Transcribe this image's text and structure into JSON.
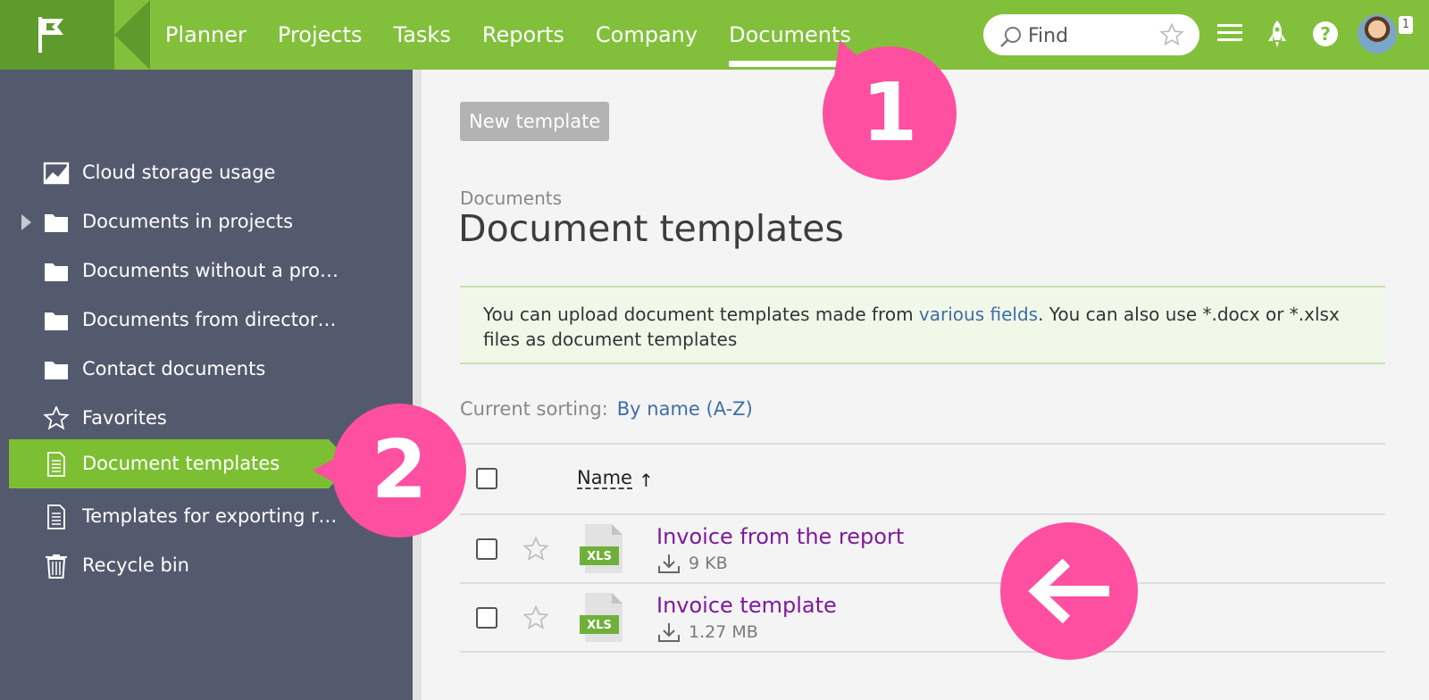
{
  "colors": {
    "topbar": "#82c03c",
    "sidebar": "#545a6e",
    "active": "#7dbf33",
    "callout": "#ff4fa0",
    "link": "#3e6ea8",
    "file_link": "#7d1a9c"
  },
  "nav": {
    "items": [
      {
        "label": "Planner"
      },
      {
        "label": "Projects"
      },
      {
        "label": "Tasks"
      },
      {
        "label": "Reports"
      },
      {
        "label": "Company"
      },
      {
        "label": "Documents",
        "active": true
      }
    ]
  },
  "search": {
    "placeholder": "Find"
  },
  "header_icons": [
    "menu-icon",
    "rocket-icon",
    "help-icon"
  ],
  "user": {
    "notification_count": "1"
  },
  "sidebar": {
    "items": [
      {
        "label": "Cloud storage usage",
        "icon": "chart-icon"
      },
      {
        "label": "Documents in projects",
        "icon": "folder-icon",
        "expandable": true
      },
      {
        "label": "Documents without a proj…",
        "icon": "folder-icon"
      },
      {
        "label": "Documents from directories",
        "icon": "folder-icon"
      },
      {
        "label": "Contact documents",
        "icon": "folder-icon"
      },
      {
        "label": "Favorites",
        "icon": "star-icon"
      },
      {
        "label": "Document templates",
        "icon": "document-icon",
        "active": true
      },
      {
        "label": "Templates for exporting re…",
        "icon": "document-icon"
      },
      {
        "label": "Recycle bin",
        "icon": "trash-icon"
      }
    ]
  },
  "main": {
    "new_template_label": "New template",
    "breadcrumb": "Documents",
    "title": "Document templates",
    "info": {
      "text_before": "You can upload document templates made from ",
      "link": "various fields",
      "text_after": ". You can also use *.docx or *.xlsx files as document templates"
    },
    "sorting": {
      "label": "Current sorting:",
      "value": "By name (A-Z)"
    },
    "table": {
      "header_name": "Name",
      "sort_indicator": "↑",
      "rows": [
        {
          "name": "Invoice from the report",
          "type": "XLS",
          "size": "9 KB"
        },
        {
          "name": "Invoice template",
          "type": "XLS",
          "size": "1.27 MB"
        }
      ]
    }
  },
  "callouts": {
    "one": "1",
    "two": "2"
  }
}
